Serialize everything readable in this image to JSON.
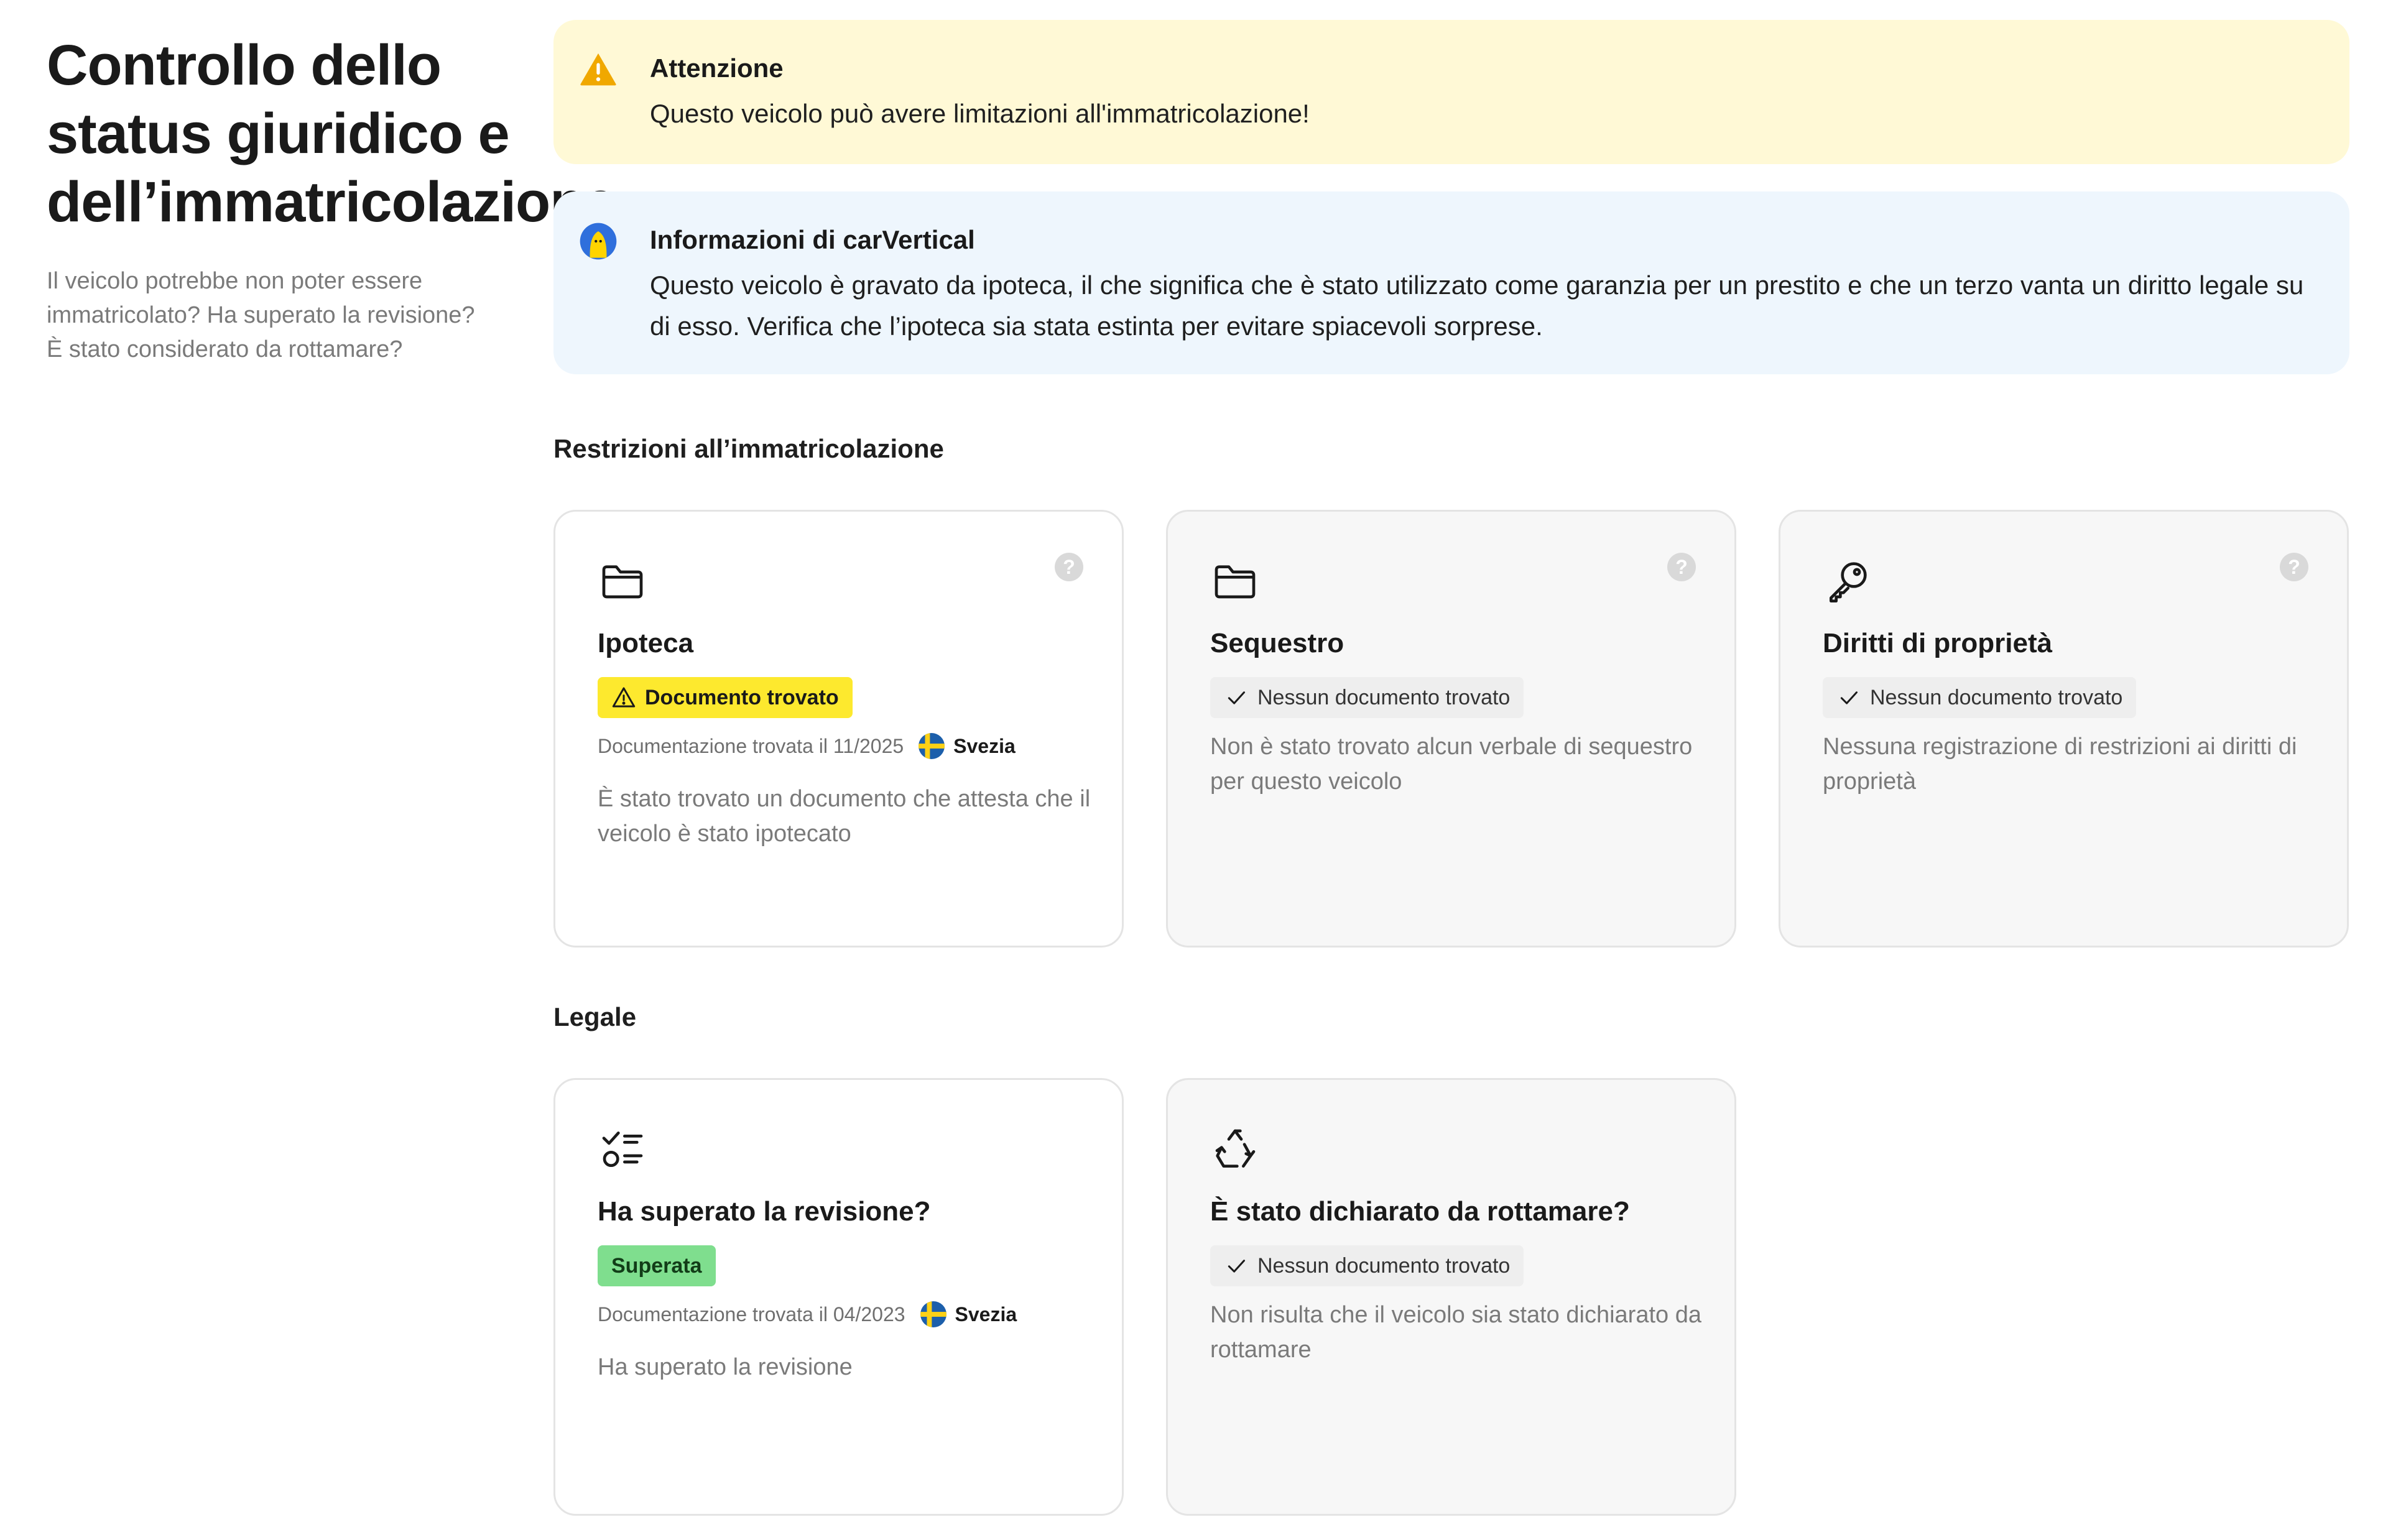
{
  "header": {
    "title": "Controllo dello status giuridico e dell’immatricolazione",
    "description": "Il veicolo potrebbe non poter essere immatricolato? Ha superato la revisione? È stato considerato da rottamare?"
  },
  "alerts": {
    "warning": {
      "icon": "warning-triangle-icon",
      "title": "Attenzione",
      "text": "Questo veicolo può avere limitazioni all'immatricolazione!",
      "color": "#fff9d6"
    },
    "info": {
      "icon": "carvertical-mascot-icon",
      "title": "Informazioni di carVertical",
      "text": "Questo veicolo è gravato da ipoteca, il che significa che è stato utilizzato come garanzia per un prestito e che un terzo vanta un diritto legale su di esso. Verifica che l’ipoteca sia stata estinta per evitare spiacevoli sorprese.",
      "color": "#eef6fd"
    }
  },
  "sections": {
    "restrictions": {
      "title": "Restrizioni all’immatricolazione",
      "cards": [
        {
          "icon": "folder-icon",
          "title": "Ipoteca",
          "badge": "Documento trovato",
          "badge_type": "warning",
          "meta": "Documentazione trovata il 11/2025",
          "country": "Svezia",
          "text": "È stato trovato un documento che attesta che il veicolo è stato ipotecato"
        },
        {
          "icon": "folder-icon",
          "title": "Sequestro",
          "badge": "Nessun documento trovato",
          "badge_type": "ok",
          "text": "Non è stato trovato alcun verbale di sequestro per questo veicolo"
        },
        {
          "icon": "key-icon",
          "title": "Diritti di proprietà",
          "badge": "Nessun documento trovato",
          "badge_type": "ok",
          "text": "Nessuna registrazione di restrizioni ai diritti di proprietà"
        }
      ]
    },
    "legal": {
      "title": "Legale",
      "cards": [
        {
          "icon": "checklist-icon",
          "title": "Ha superato la revisione?",
          "badge": "Superata",
          "badge_type": "pass",
          "meta": "Documentazione trovata il 04/2023",
          "country": "Svezia",
          "text": "Ha superato la revisione"
        },
        {
          "icon": "recycle-icon",
          "title": "È stato dichiarato da rottamare?",
          "badge": "Nessun documento trovato",
          "badge_type": "ok",
          "text": "Non risulta che il veicolo sia stato dichiarato da rottamare"
        }
      ]
    }
  },
  "help_label": "?",
  "colors": {
    "badge_warning": "#fde92e",
    "badge_pass": "#7fde8e",
    "badge_ok": "#eeeeee",
    "alert_icon_warning": "#f0a800",
    "flag_blue": "#1c5fab",
    "flag_yellow": "#fcd116"
  }
}
